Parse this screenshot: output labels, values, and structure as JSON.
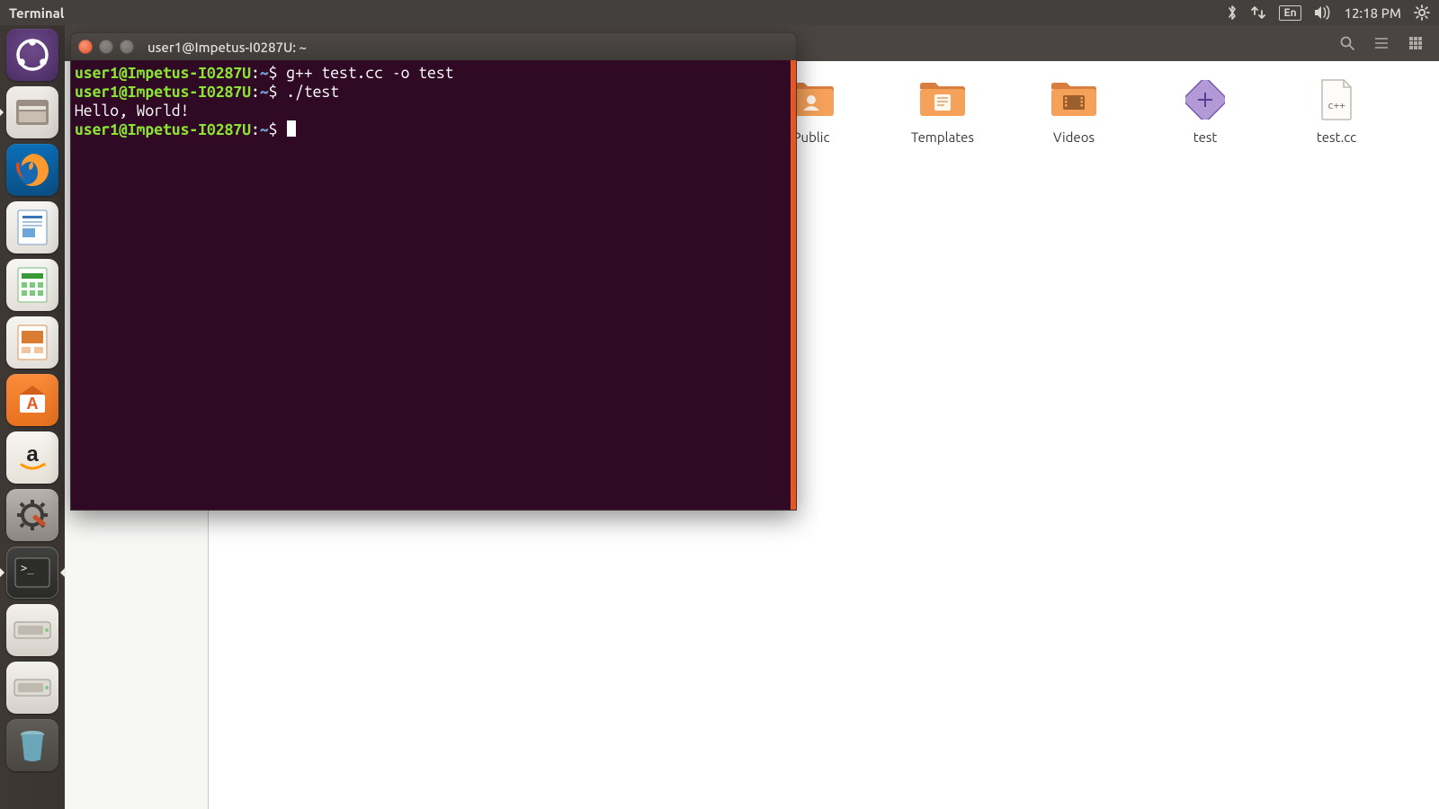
{
  "menubar": {
    "app_title": "Terminal",
    "language": "En",
    "clock": "12:18 PM"
  },
  "launcher": {
    "items": [
      {
        "name": "dash-icon"
      },
      {
        "name": "files-icon"
      },
      {
        "name": "firefox-icon"
      },
      {
        "name": "writer-icon"
      },
      {
        "name": "calc-icon"
      },
      {
        "name": "impress-icon"
      },
      {
        "name": "software-icon"
      },
      {
        "name": "amazon-icon"
      },
      {
        "name": "settings-icon"
      },
      {
        "name": "terminal-icon"
      },
      {
        "name": "drive1-icon"
      },
      {
        "name": "drive2-icon"
      },
      {
        "name": "trash-icon"
      }
    ]
  },
  "nautilus": {
    "files": [
      {
        "label": "Public",
        "type": "folder-public"
      },
      {
        "label": "Templates",
        "type": "folder-templates"
      },
      {
        "label": "Videos",
        "type": "folder-videos"
      },
      {
        "label": "test",
        "type": "executable"
      },
      {
        "label": "test.cc",
        "type": "source-cpp"
      }
    ]
  },
  "terminal": {
    "window_title": "user1@Impetus-I0287U: ~",
    "prompt_user_host": "user1@Impetus-I0287U",
    "prompt_path": "~",
    "prompt_symbol": "$",
    "lines": [
      {
        "cmd": "g++ test.cc -o test"
      },
      {
        "cmd": "./test"
      },
      {
        "output": "Hello, World!"
      },
      {
        "cmd": ""
      }
    ]
  }
}
